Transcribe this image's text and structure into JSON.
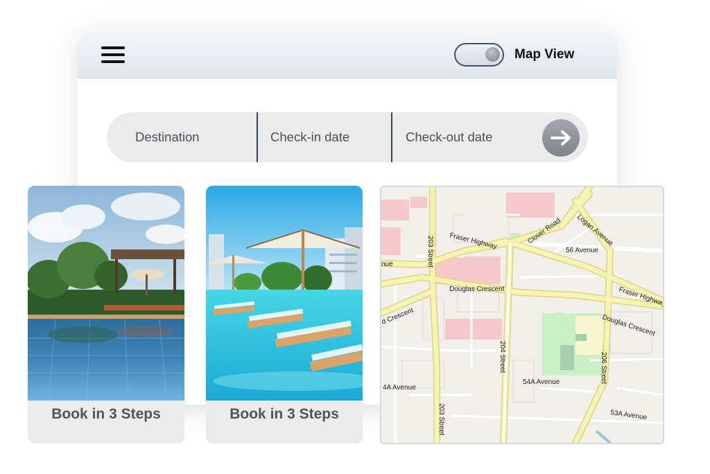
{
  "header": {
    "menu_icon": "hamburger-menu-icon",
    "map_view_toggle": {
      "label": "Map View",
      "state": "on"
    }
  },
  "search": {
    "fields": [
      {
        "label": "Destination"
      },
      {
        "label": "Check-in date"
      },
      {
        "label": "Check-out date"
      }
    ],
    "submit_icon": "arrow-right-icon"
  },
  "cards": [
    {
      "caption": "Book in 3 Steps",
      "image": "resort pool with sun loungers and garden canopy"
    },
    {
      "caption": "Book in 3 Steps",
      "image": "pool with parasols and lounge chairs near high-rise buildings"
    }
  ],
  "map": {
    "labels": {
      "fraser_highway_w": "Fraser Highway",
      "fraser_highway_e": "Fraser Highway",
      "clover_road": "Clover Road",
      "logan_avenue": "Logan Avenue",
      "ave_56": "56 Avenue",
      "street_203_top": "203 Street",
      "street_203_bottom": "203 Street",
      "douglas_crescent": "Douglas Crescent",
      "douglas_crescent_e": "Douglas Crescent",
      "d_crescent_w": "d Crescent",
      "nue": "nue",
      "street_204": "204 Street",
      "street_206": "206 Street",
      "ave_54a": "54A Avenue",
      "ave_4a": "4A Avenue",
      "ave_53a": "53A Avenue"
    }
  },
  "colors": {
    "header_gradient_top": "#f4f6f9",
    "header_gradient_bottom": "#dfe4ec",
    "search_bar_bg": "#ebebec",
    "caption_text": "#4f545b",
    "field_divider": "#3a4660",
    "map_major_road": "#f4f3b4",
    "map_park": "#c8f0c4"
  }
}
